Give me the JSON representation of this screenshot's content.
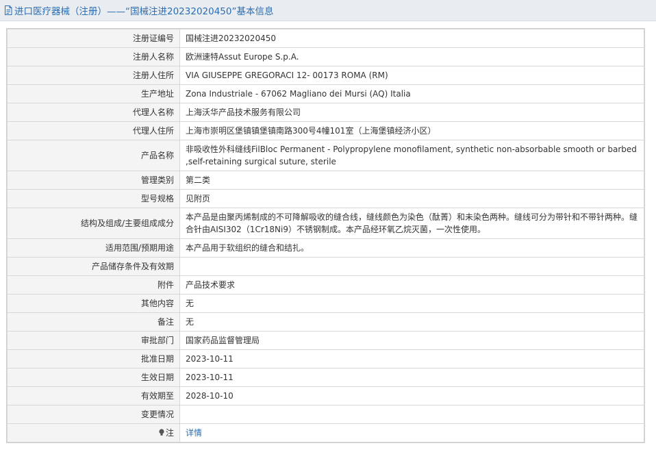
{
  "header": {
    "title": "进口医疗器械（注册）——“国械注进20232020450”基本信息"
  },
  "rows": [
    {
      "label": "注册证编号",
      "value": "国械注进20232020450"
    },
    {
      "label": "注册人名称",
      "value": "欧洲速特Assut Europe S.p.A."
    },
    {
      "label": "注册人住所",
      "value": "VIA GIUSEPPE GREGORACI 12- 00173 ROMA (RM)"
    },
    {
      "label": "生产地址",
      "value": "Zona Industriale - 67062 Magliano dei Mursi (AQ) Italia"
    },
    {
      "label": "代理人名称",
      "value": "上海沃华产品技术服务有限公司"
    },
    {
      "label": "代理人住所",
      "value": "上海市崇明区堡镇镇堡镇南路300号4幢101室（上海堡镇经济小区）"
    },
    {
      "label": "产品名称",
      "value": "非吸收性外科缝线FilBloc Permanent - Polypropylene monofilament, synthetic non-absorbable smooth or barbed ,self-retaining surgical suture, sterile"
    },
    {
      "label": "管理类别",
      "value": "第二类"
    },
    {
      "label": "型号规格",
      "value": "见附页"
    },
    {
      "label": "结构及组成/主要组成成分",
      "value": "本产品是由聚丙烯制成的不可降解吸收的缝合线，缝线颜色为染色（酞菁）和未染色两种。缝线可分为带针和不带针两种。缝合针由AISI302（1Cr18Ni9）不锈钢制成。本产品经环氧乙烷灭菌，一次性使用。"
    },
    {
      "label": "适用范围/预期用途",
      "value": "本产品用于软组织的缝合和结扎。"
    },
    {
      "label": "产品储存条件及有效期",
      "value": ""
    },
    {
      "label": "附件",
      "value": "产品技术要求"
    },
    {
      "label": "其他内容",
      "value": "无"
    },
    {
      "label": "备注",
      "value": "无"
    },
    {
      "label": "审批部门",
      "value": "国家药品监督管理局"
    },
    {
      "label": "批准日期",
      "value": "2023-10-11"
    },
    {
      "label": "生效日期",
      "value": "2023-10-11"
    },
    {
      "label": "有效期至",
      "value": "2028-10-10"
    },
    {
      "label": "变更情况",
      "value": ""
    }
  ],
  "note": {
    "label": "注",
    "link_text": "详情"
  }
}
